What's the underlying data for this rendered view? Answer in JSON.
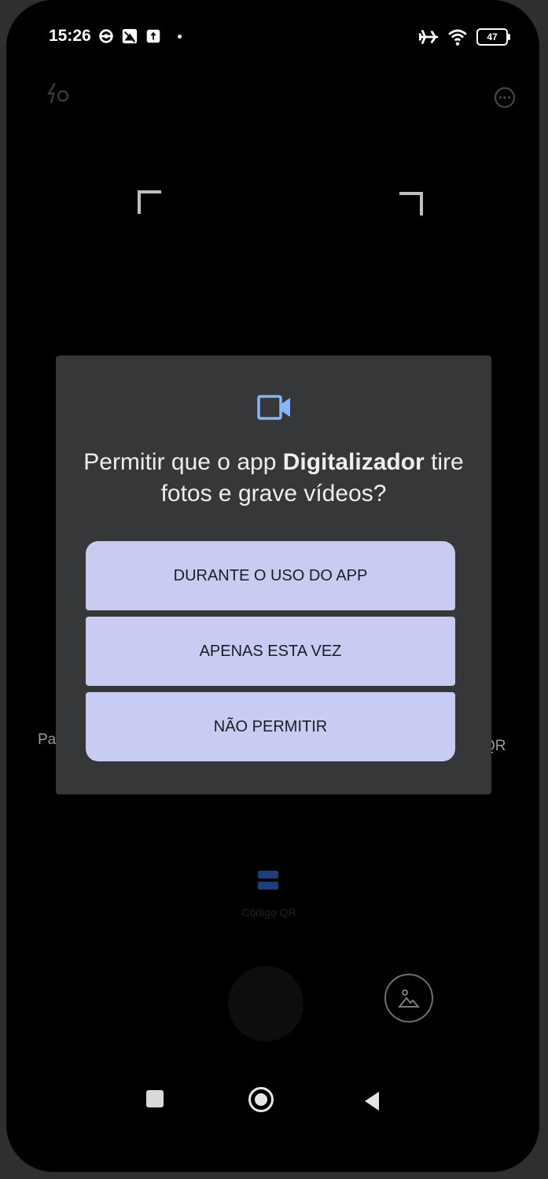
{
  "status_bar": {
    "time": "15:26",
    "battery_level": "47",
    "icons_left": [
      "settings-gear-icon",
      "gallery-notification-icon",
      "upload-notification-icon",
      "notification-dot"
    ],
    "icons_right": [
      "airplane-mode-icon",
      "wifi-icon",
      "battery-icon"
    ]
  },
  "camera": {
    "side_label_left": "Pa",
    "side_label_right": "QR",
    "mode_label": "Código QR"
  },
  "dialog": {
    "title_prefix": "Permitir que o app ",
    "app_name": "Digitalizador",
    "title_suffix": " tire fotos e grave vídeos?",
    "buttons": [
      {
        "label": "DURANTE O USO DO APP"
      },
      {
        "label": "APENAS ESTA VEZ"
      },
      {
        "label": "NÃO PERMITIR"
      }
    ],
    "icon": "videocam-icon",
    "accent_color": "#8ab4f8",
    "button_color": "#c8ccf2"
  },
  "nav_bar": {
    "icons": [
      "recents-square-icon",
      "home-circle-icon",
      "back-triangle-icon"
    ]
  }
}
